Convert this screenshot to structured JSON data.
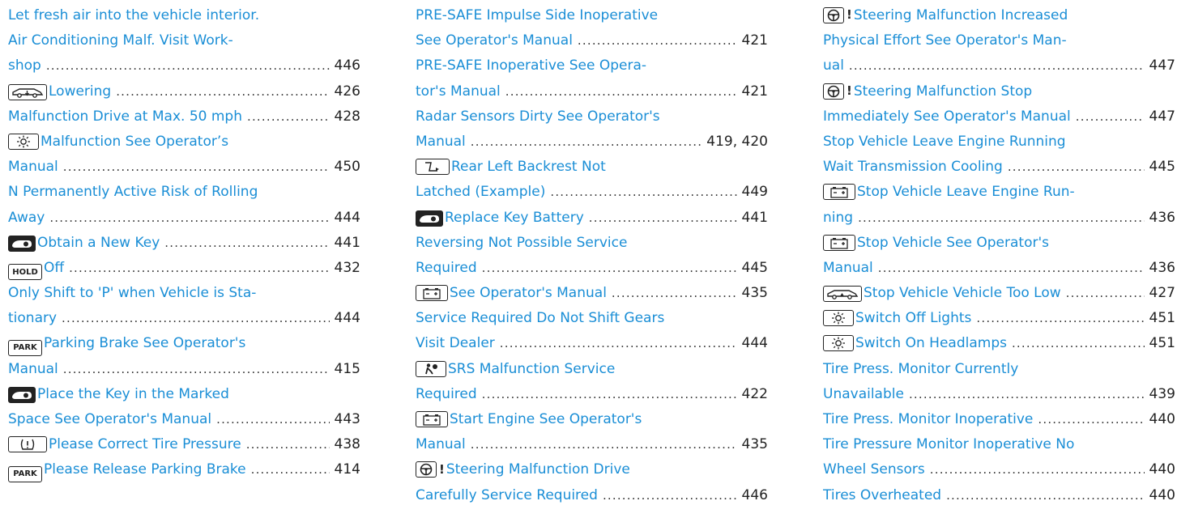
{
  "columns": [
    [
      {
        "lines": [
          "Let fresh air into the vehicle interior."
        ]
      },
      {
        "lines": [
          "Air Conditioning Malf. Visit Work-",
          "shop"
        ],
        "page": "446"
      },
      {
        "icon": "vehicle-lowering-icon",
        "lines": [
          "Lowering"
        ],
        "page": "426"
      },
      {
        "lines": [
          "Malfunction Drive at Max. 50 mph"
        ],
        "page": "428"
      },
      {
        "icon": "light-icon",
        "lines": [
          "Malfunction See Operator’s",
          "Manual"
        ],
        "page": "450"
      },
      {
        "lines": [
          "N Permanently Active Risk of Rolling",
          "Away"
        ],
        "page": "444"
      },
      {
        "icon": "key-icon",
        "lines": [
          "Obtain a New Key"
        ],
        "page": "441"
      },
      {
        "icon": "hold-icon",
        "icon_text": "HOLD",
        "lines": [
          "Off"
        ],
        "page": "432"
      },
      {
        "lines": [
          "Only Shift to 'P' when Vehicle is Sta-",
          "tionary"
        ],
        "page": "444"
      },
      {
        "icon": "park-icon",
        "icon_text": "PARK",
        "lines": [
          "Parking Brake See Operator's",
          "Manual"
        ],
        "page": "415"
      },
      {
        "icon": "key-icon",
        "lines": [
          "Place the Key in the Marked",
          "Space See Operator's Manual"
        ],
        "page": "443"
      },
      {
        "icon": "tire-pressure-icon",
        "lines": [
          "Please Correct Tire Pressure"
        ],
        "page": "438"
      },
      {
        "icon": "park-icon",
        "icon_text": "PARK",
        "lines": [
          "Please Release Parking Brake"
        ],
        "page": "414"
      }
    ],
    [
      {
        "lines": [
          "PRE-SAFE Impulse Side Inoperative",
          "See Operator's Manual"
        ],
        "page": "421"
      },
      {
        "lines": [
          "PRE-SAFE Inoperative See Opera-",
          "tor's Manual"
        ],
        "page": "421"
      },
      {
        "lines": [
          "Radar Sensors Dirty See Operator's",
          "Manual"
        ],
        "page": "419, 420"
      },
      {
        "icon": "backrest-icon",
        "lines": [
          "Rear Left Backrest Not",
          "Latched (Example)"
        ],
        "page": "449"
      },
      {
        "icon": "key-icon",
        "lines": [
          "Replace Key Battery"
        ],
        "page": "441"
      },
      {
        "lines": [
          "Reversing Not Possible Service",
          "Required"
        ],
        "page": "445"
      },
      {
        "icon": "battery-icon",
        "lines": [
          "See Operator's Manual"
        ],
        "page": "435"
      },
      {
        "lines": [
          "Service Required Do Not Shift Gears",
          "Visit Dealer"
        ],
        "page": "444"
      },
      {
        "icon": "airbag-icon",
        "lines": [
          "SRS Malfunction Service",
          "Required"
        ],
        "page": "422"
      },
      {
        "icon": "battery-icon",
        "lines": [
          "Start Engine See Operator's",
          "Manual"
        ],
        "page": "435"
      },
      {
        "icon": "steering-warning-icon",
        "icon_text": "!",
        "lines": [
          "Steering Malfunction Drive",
          "Carefully Service Required"
        ],
        "page": "446"
      }
    ],
    [
      {
        "icon": "steering-warning-icon",
        "icon_text": "!",
        "lines": [
          "Steering Malfunction Increased",
          "Physical Effort See Operator's Man-",
          "ual"
        ],
        "page": "447"
      },
      {
        "icon": "steering-warning-icon",
        "icon_text": "!",
        "lines": [
          "Steering Malfunction Stop",
          "Immediately See Operator's Manual"
        ],
        "page": "447"
      },
      {
        "lines": [
          "Stop Vehicle Leave Engine Running",
          "Wait Transmission Cooling"
        ],
        "page": "445"
      },
      {
        "icon": "battery-icon",
        "lines": [
          "Stop Vehicle Leave Engine Run-",
          "ning"
        ],
        "page": "436"
      },
      {
        "icon": "battery-icon",
        "lines": [
          "Stop Vehicle See Operator's",
          "Manual"
        ],
        "page": "436"
      },
      {
        "icon": "vehicle-low-icon",
        "lines": [
          "Stop Vehicle Vehicle Too Low"
        ],
        "page": "427"
      },
      {
        "icon": "light-icon",
        "lines": [
          "Switch Off Lights"
        ],
        "page": "451"
      },
      {
        "icon": "light-icon",
        "lines": [
          "Switch On Headlamps"
        ],
        "page": "451"
      },
      {
        "lines": [
          "Tire Press. Monitor Currently",
          "Unavailable"
        ],
        "page": "439"
      },
      {
        "lines": [
          "Tire Press. Monitor Inoperative"
        ],
        "page": "440"
      },
      {
        "lines": [
          "Tire Pressure Monitor Inoperative No",
          "Wheel Sensors"
        ],
        "page": "440"
      },
      {
        "lines": [
          "Tires Overheated"
        ],
        "page": "440"
      }
    ]
  ]
}
